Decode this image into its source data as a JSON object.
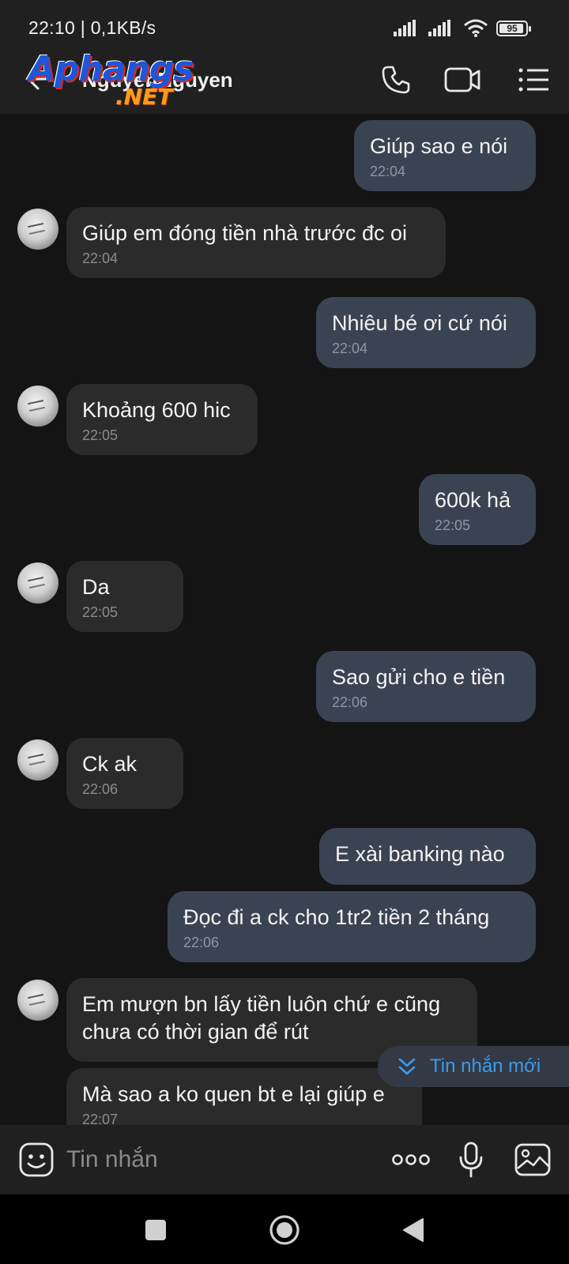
{
  "status_bar": {
    "time_speed": "22:10 | 0,1KB/s",
    "battery": "95",
    "battery_level": 0.95
  },
  "header": {
    "contact_name": "NguyenNguyen",
    "watermark_main": "Aphangs",
    "watermark_sub": ".NET"
  },
  "messages": [
    {
      "dir": "out",
      "text": "Giúp sao e nói",
      "time": "22:04"
    },
    {
      "dir": "in",
      "text": "Giúp em đóng tiền nhà trước đc oi",
      "time": "22:04"
    },
    {
      "dir": "out",
      "text": "Nhiêu bé ơi cứ nói",
      "time": "22:04"
    },
    {
      "dir": "in",
      "text": "Khoảng 600 hic",
      "time": "22:05"
    },
    {
      "dir": "out",
      "text": "600k hả",
      "time": "22:05"
    },
    {
      "dir": "in",
      "text": "Da",
      "time": "22:05"
    },
    {
      "dir": "out",
      "text": "Sao gửi cho e tiền",
      "time": "22:06"
    },
    {
      "dir": "in",
      "text": "Ck ak",
      "time": "22:06"
    },
    {
      "dir": "out",
      "text": "E xài banking nào",
      "time": ""
    },
    {
      "dir": "out",
      "text": "Đọc đi a ck cho 1tr2 tiền 2 tháng",
      "time": "22:06"
    },
    {
      "dir": "in",
      "text": "Em mượn bn lấy tiền luôn chứ e cũng\nchưa có thời gian để rút",
      "time": ""
    },
    {
      "dir": "in",
      "text": "Mà sao a ko quen bt e lại giúp e",
      "time": "22:07"
    }
  ],
  "new_messages_label": "Tin nhắn mới",
  "composer": {
    "placeholder": "Tin nhắn"
  },
  "icons": {
    "back": "back-arrow-icon",
    "call": "phone-icon",
    "video": "video-camera-icon",
    "menu": "list-menu-icon",
    "sticker": "smiley-sticker-icon",
    "more": "more-dots-icon",
    "mic": "microphone-icon",
    "image": "image-gallery-icon",
    "nav_recent": "recent-apps-icon",
    "nav_home": "home-icon",
    "nav_back": "nav-back-icon"
  },
  "colors": {
    "bubble_out": "#3a4352",
    "bubble_in": "#2b2b2b",
    "accent": "#3d9be9"
  }
}
